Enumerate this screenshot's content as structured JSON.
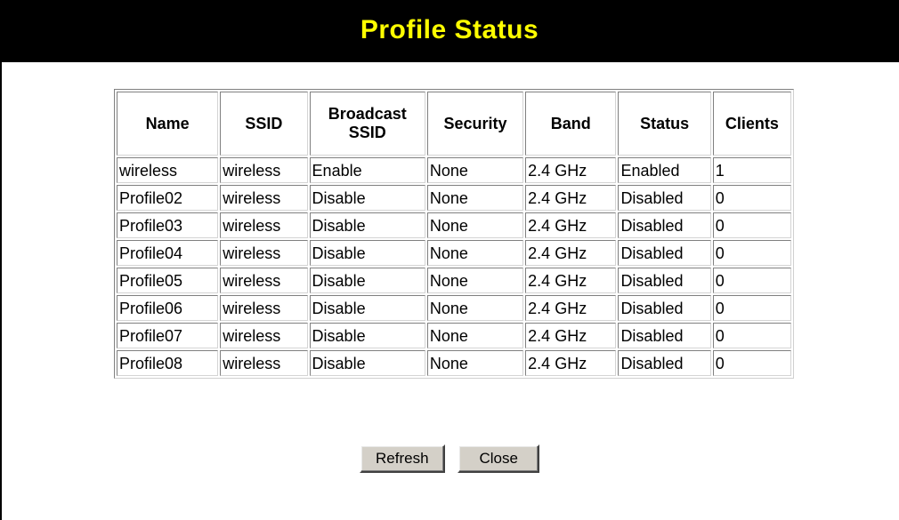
{
  "header": {
    "title": "Profile Status"
  },
  "table": {
    "columns": [
      "Name",
      "SSID",
      "Broadcast SSID",
      "Security",
      "Band",
      "Status",
      "Clients"
    ],
    "header_lines": {
      "broadcast_line1": "Broadcast",
      "broadcast_line2": "SSID"
    },
    "rows": [
      {
        "name": "wireless",
        "ssid": "wireless",
        "broadcast": "Enable",
        "security": "None",
        "band": "2.4 GHz",
        "status": "Enabled",
        "clients": "1"
      },
      {
        "name": "Profile02",
        "ssid": "wireless",
        "broadcast": "Disable",
        "security": "None",
        "band": "2.4 GHz",
        "status": "Disabled",
        "clients": "0"
      },
      {
        "name": "Profile03",
        "ssid": "wireless",
        "broadcast": "Disable",
        "security": "None",
        "band": "2.4 GHz",
        "status": "Disabled",
        "clients": "0"
      },
      {
        "name": "Profile04",
        "ssid": "wireless",
        "broadcast": "Disable",
        "security": "None",
        "band": "2.4 GHz",
        "status": "Disabled",
        "clients": "0"
      },
      {
        "name": "Profile05",
        "ssid": "wireless",
        "broadcast": "Disable",
        "security": "None",
        "band": "2.4 GHz",
        "status": "Disabled",
        "clients": "0"
      },
      {
        "name": "Profile06",
        "ssid": "wireless",
        "broadcast": "Disable",
        "security": "None",
        "band": "2.4 GHz",
        "status": "Disabled",
        "clients": "0"
      },
      {
        "name": "Profile07",
        "ssid": "wireless",
        "broadcast": "Disable",
        "security": "None",
        "band": "2.4 GHz",
        "status": "Disabled",
        "clients": "0"
      },
      {
        "name": "Profile08",
        "ssid": "wireless",
        "broadcast": "Disable",
        "security": "None",
        "band": "2.4 GHz",
        "status": "Disabled",
        "clients": "0"
      }
    ]
  },
  "buttons": {
    "refresh_label": "Refresh",
    "close_label": "Close"
  },
  "colors": {
    "header_background": "#000000",
    "header_text": "#ffff00",
    "button_face": "#d4d0c8"
  }
}
